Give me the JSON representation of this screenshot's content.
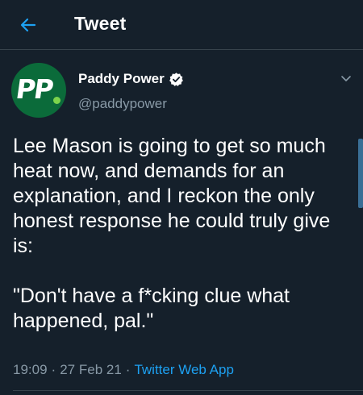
{
  "colors": {
    "background": "#15202b",
    "accent": "#1da1f2",
    "muted": "#8899a6",
    "divider": "#38444d",
    "avatar_bg": "#0b6b3a"
  },
  "header": {
    "back_icon": "arrow-left-icon",
    "title": "Tweet"
  },
  "tweet": {
    "avatar_text": "PP",
    "display_name": "Paddy Power",
    "verified_icon": "verified-badge-icon",
    "handle": "@paddypower",
    "menu_icon": "chevron-down-icon",
    "text": "Lee Mason is going to get so much heat now, and demands for an explanation, and I reckon the only honest response he could truly give is:\n\n\"Don't have a f*cking clue what happened, pal.\"",
    "time": "19:09",
    "date": "27 Feb 21",
    "source": "Twitter Web App",
    "separator": "·"
  }
}
